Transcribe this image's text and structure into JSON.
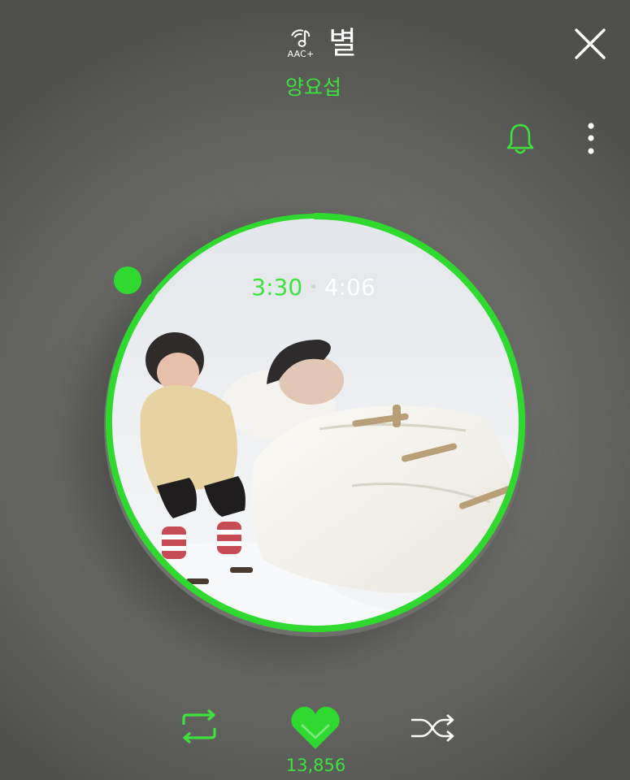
{
  "header": {
    "quality_label": "AAC+",
    "song_title": "별",
    "artist": "양요섭",
    "icons": {
      "quality": "music-note-quality-icon",
      "close": "close-icon",
      "bell": "bell-icon",
      "more": "more-vertical-icon"
    }
  },
  "player": {
    "current_time": "3:30",
    "total_time": "4:06",
    "progress_fraction": 0.854,
    "like_count": "13,856"
  },
  "controls": {
    "repeat_icon": "repeat-icon",
    "like_icon": "heart-icon",
    "shuffle_icon": "shuffle-icon"
  },
  "colors": {
    "accent": "#3ee23e",
    "progress": "#2fd92f",
    "text_primary": "#ffffff",
    "background": "#6a6a67"
  }
}
